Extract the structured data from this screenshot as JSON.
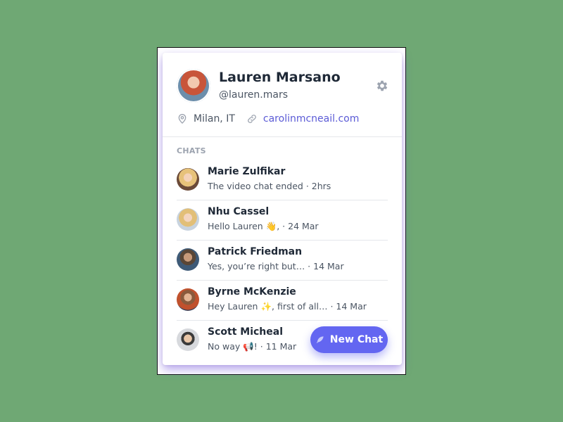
{
  "profile": {
    "name": "Lauren Marsano",
    "handle": "@lauren.mars",
    "location": "Milan, IT",
    "website": "carolinmcneail.com"
  },
  "chats": {
    "section_label": "CHATS",
    "items": [
      {
        "name": "Marie Zulfikar",
        "preview": "The video chat ended · 2hrs"
      },
      {
        "name": "Nhu Cassel",
        "preview": "Hello Lauren 👋, · 24 Mar"
      },
      {
        "name": "Patrick Friedman",
        "preview": "Yes, you’re right but… · 14 Mar"
      },
      {
        "name": "Byrne McKenzie",
        "preview": "Hey Lauren ✨, first of all… · 14 Mar"
      },
      {
        "name": "Scott Micheal",
        "preview": "No way 📢! · 11 Mar"
      }
    ]
  },
  "actions": {
    "new_chat_label": "New Chat"
  },
  "icons": {
    "settings": "gear-icon",
    "location": "map-pin-icon",
    "website": "link-icon",
    "new_chat": "feather-icon"
  },
  "colors": {
    "accent": "#6366f1",
    "link": "#5b5bd6",
    "background": "#6fa874"
  }
}
